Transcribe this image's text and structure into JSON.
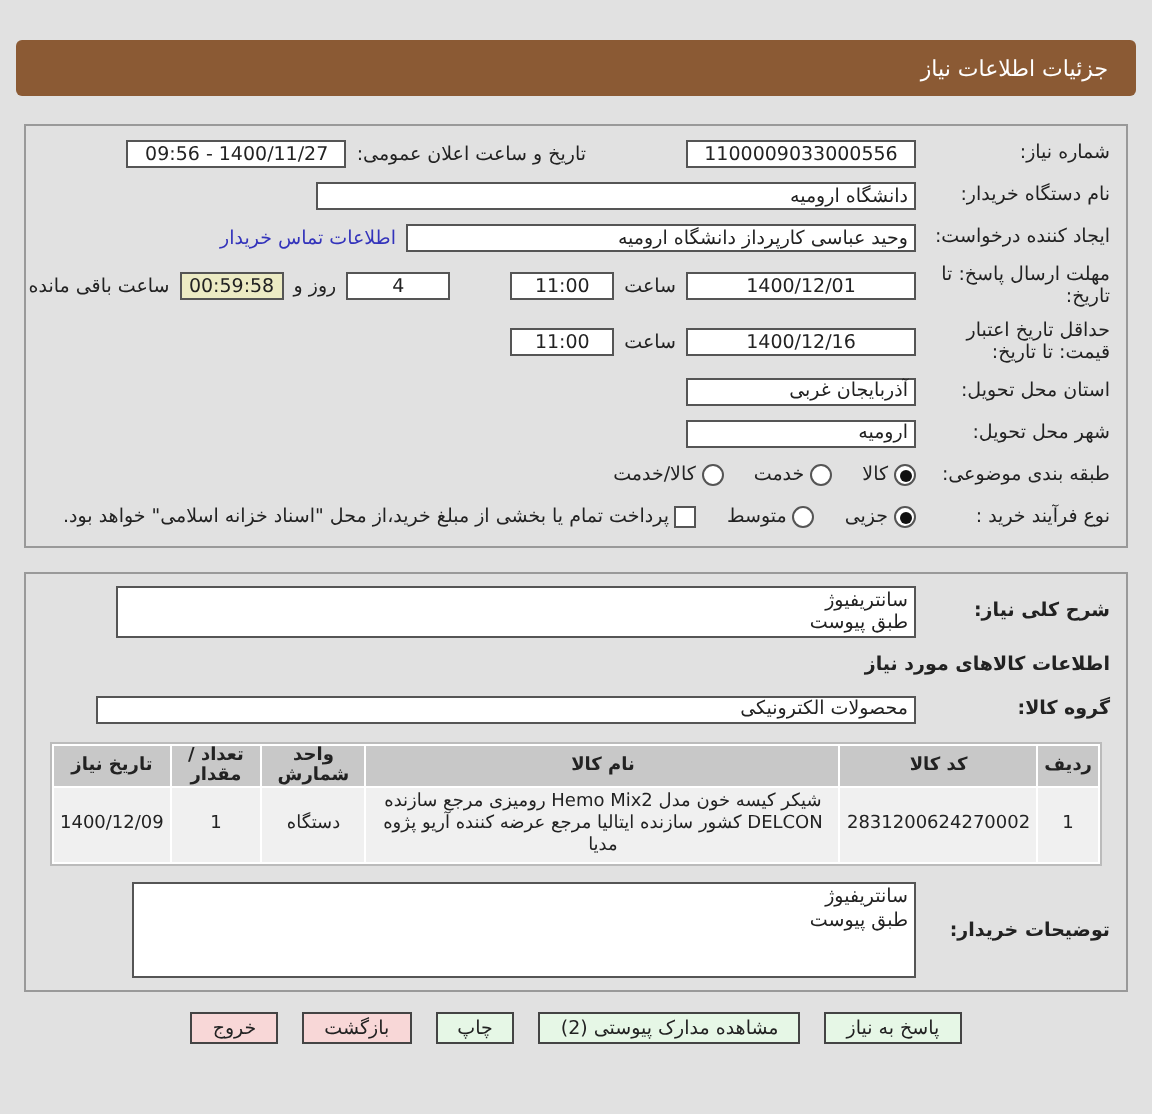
{
  "header": {
    "title": "جزئیات اطلاعات نیاز"
  },
  "details": {
    "need_number": {
      "label": "شماره نیاز:",
      "value": "1100009033000556"
    },
    "announce": {
      "label": "تاریخ و ساعت اعلان عمومی:",
      "value": "1400/11/27 - 09:56"
    },
    "buyer_org": {
      "label": "نام دستگاه خریدار:",
      "value": "دانشگاه ارومیه"
    },
    "creator": {
      "label": "ایجاد کننده درخواست:",
      "value": "وحید عباسی کارپرداز دانشگاه ارومیه",
      "link": "اطلاعات تماس خریدار"
    },
    "deadline": {
      "label": "مهلت ارسال پاسخ: تا تاریخ:",
      "date": "1400/12/01",
      "time_label": "ساعت",
      "time": "11:00",
      "days": "4",
      "days_label": "روز و",
      "remaining": "00:59:58",
      "remaining_label": "ساعت باقی مانده"
    },
    "validity": {
      "label": "حداقل تاریخ اعتبار قیمت: تا تاریخ:",
      "date": "1400/12/16",
      "time_label": "ساعت",
      "time": "11:00"
    },
    "province": {
      "label": "استان محل تحویل:",
      "value": "آذربایجان غربی"
    },
    "city": {
      "label": "شهر محل تحویل:",
      "value": "ارومیه"
    },
    "category": {
      "label": "طبقه بندی موضوعی:",
      "options": [
        {
          "label": "کالا",
          "selected": true
        },
        {
          "label": "خدمت",
          "selected": false
        },
        {
          "label": "کالا/خدمت",
          "selected": false
        }
      ]
    },
    "process": {
      "label": "نوع فرآیند خرید :",
      "options": [
        {
          "label": "جزیی",
          "selected": true
        },
        {
          "label": "متوسط",
          "selected": false
        }
      ],
      "treasury": {
        "label": "پرداخت تمام یا بخشی از مبلغ خرید،از محل \"اسناد خزانه اسلامی\" خواهد بود.",
        "checked": false
      }
    }
  },
  "needs": {
    "description": {
      "label": "شرح کلی نیاز:",
      "lines": [
        "سانتریفیوژ",
        "طبق پیوست"
      ]
    },
    "section_title": "اطلاعات کالاهای مورد نیاز",
    "goods_group": {
      "label": "گروه کالا:",
      "value": "محصولات الکترونیکی"
    },
    "table": {
      "columns": [
        "ردیف",
        "کد کالا",
        "نام کالا",
        "واحد شمارش",
        "تعداد / مقدار",
        "تاریخ نیاز"
      ],
      "rows": [
        [
          "1",
          "2831200624270002",
          "شیکر کیسه خون مدل Hemo Mix2 رومیزی مرجع سازنده DELCON کشور سازنده ایتالیا مرجع عرضه کننده آریو پژوه مدیا",
          "دستگاه",
          "1",
          "1400/12/09"
        ]
      ]
    },
    "buyer_notes": {
      "label": "توضیحات خریدار:",
      "lines": [
        "سانتریفیوژ",
        "طبق پیوست"
      ]
    }
  },
  "buttons": [
    {
      "label": "پاسخ به نیاز",
      "kind": "primary"
    },
    {
      "label": "مشاهده مدارک پیوستی (2)",
      "kind": "primary"
    },
    {
      "label": "چاپ",
      "kind": "primary"
    },
    {
      "label": "بازگشت",
      "kind": "danger"
    },
    {
      "label": "خروج",
      "kind": "danger"
    }
  ]
}
